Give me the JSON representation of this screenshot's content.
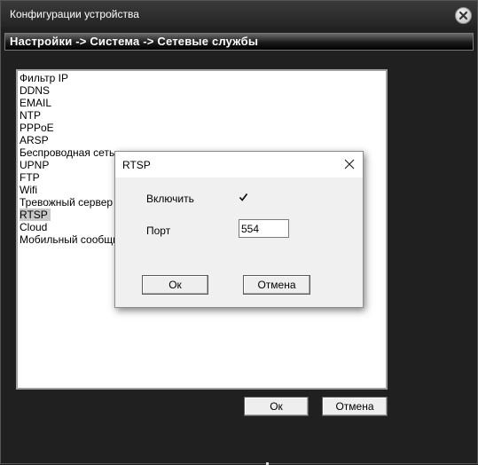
{
  "window": {
    "title": "Конфигурации устройства",
    "breadcrumb": "Настройки -> Система -> Сетевые службы"
  },
  "services": [
    {
      "label": "Фильтр IP"
    },
    {
      "label": "DDNS"
    },
    {
      "label": "EMAIL"
    },
    {
      "label": "NTP"
    },
    {
      "label": "PPPoE"
    },
    {
      "label": "ARSP"
    },
    {
      "label": "Беспроводная сеть"
    },
    {
      "label": "UPNP"
    },
    {
      "label": "FTP"
    },
    {
      "label": "Wifi"
    },
    {
      "label": "Тревожный сервер"
    },
    {
      "label": "RTSP",
      "selected": true
    },
    {
      "label": "Cloud"
    },
    {
      "label": "Мобильный сообщил"
    }
  ],
  "footer": {
    "ok_label": "Ок",
    "cancel_label": "Отмена"
  },
  "dialog": {
    "title": "RTSP",
    "enable_label": "Включить",
    "enable_checked": true,
    "port_label": "Порт",
    "port_value": "554",
    "ok_label": "Ок",
    "cancel_label": "Отмена"
  },
  "icons": {
    "window_close": "close-icon",
    "dialog_close": "close-icon",
    "checkbox": "checkmark-icon"
  }
}
